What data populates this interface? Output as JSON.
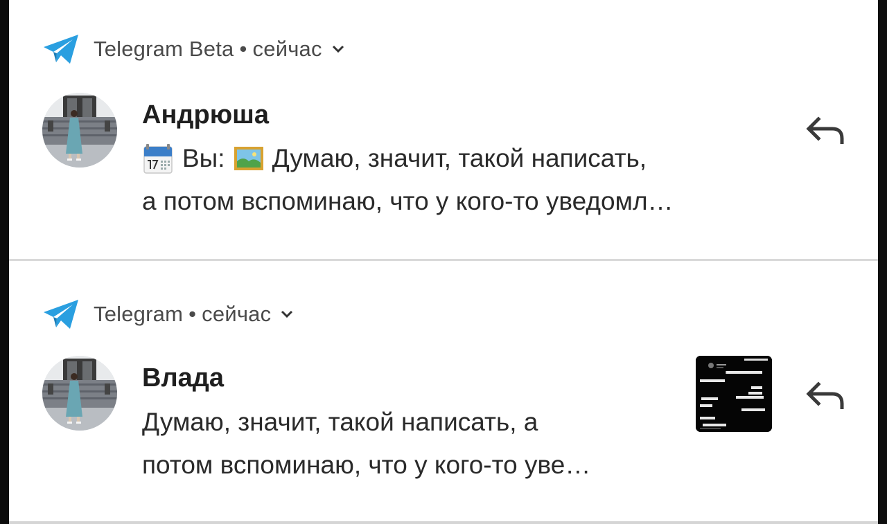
{
  "notifications": [
    {
      "app_name": "Telegram Beta",
      "time": "сейчас",
      "sender": "Андрюша",
      "prefix": "Вы:",
      "message_line1": "Думаю, значит, такой написать,",
      "message_line2": "а потом вспоминаю, что у кого-то уведомл…",
      "icons": [
        "telegram-logo",
        "expand-chevron",
        "calendar-emoji",
        "picture-emoji",
        "reply-arrow"
      ]
    },
    {
      "app_name": "Telegram",
      "time": "сейчас",
      "sender": "Влада",
      "message_line1": "Думаю, значит, такой написать, а",
      "message_line2": "потом вспоминаю, что у кого-то уве…",
      "icons": [
        "telegram-logo",
        "expand-chevron",
        "image-thumbnail",
        "reply-arrow"
      ]
    }
  ],
  "separator": "•",
  "colors": {
    "telegram_blue": "#2A9FE0",
    "background": "#FFFFFF",
    "divider": "#D9D9D9"
  }
}
